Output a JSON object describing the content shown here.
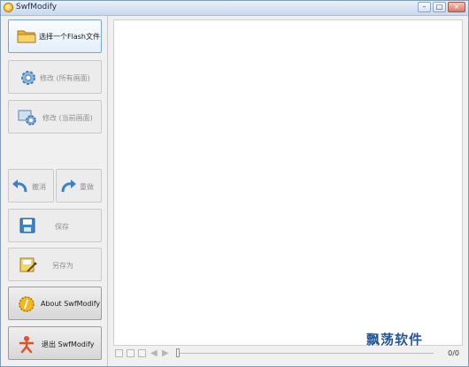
{
  "window": {
    "title": "SwfModify"
  },
  "sidebar": {
    "open_file": "选择一个Flash文件",
    "modify_all": "修改 (所有画面)",
    "modify_current": "修改 (当前画面)",
    "undo": "撤消",
    "redo": "重做",
    "save": "保存",
    "save_as": "另存为",
    "about": "About SwfModify",
    "exit": "退出 SwfModify"
  },
  "player": {
    "frame_counter": "0/0",
    "position_fraction": 0
  },
  "watermark": "飘荡软件"
}
